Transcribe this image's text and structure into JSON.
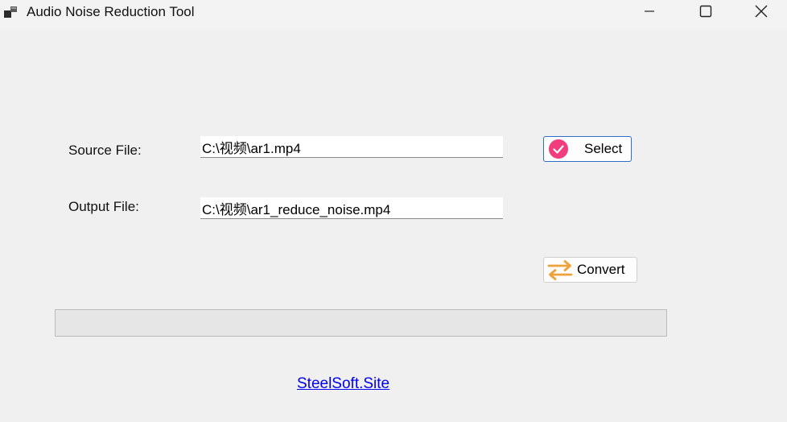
{
  "window": {
    "title": "Audio Noise Reduction Tool",
    "icons": {
      "app": "app-window-icon",
      "minimize": "minimize-icon",
      "maximize": "maximize-icon",
      "close": "close-icon"
    }
  },
  "form": {
    "source_label": "Source File:",
    "source_value": "C:\\视频\\ar1.mp4",
    "output_label": "Output File:",
    "output_value": "C:\\视频\\ar1_reduce_noise.mp4"
  },
  "buttons": {
    "select_label": "Select",
    "select_icon": "pink-checkmark-circle-icon",
    "convert_label": "Convert",
    "convert_icon": "orange-swap-arrows-icon"
  },
  "progress": {
    "value": 0
  },
  "footer": {
    "link_text": "SteelSoft.Site"
  },
  "colors": {
    "select_icon": "#f13c7e",
    "convert_icon": "#f0a23a",
    "link": "#0000ee",
    "select_border": "#2b6fc6"
  }
}
